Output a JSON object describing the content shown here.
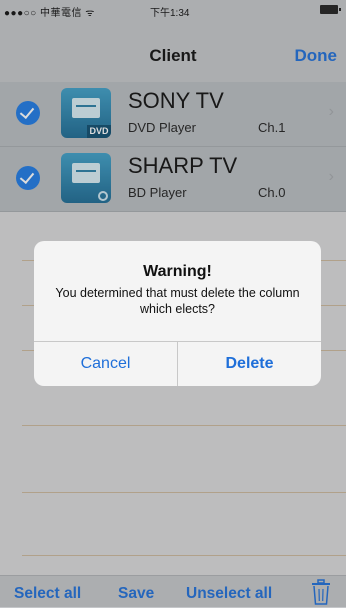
{
  "status_bar": {
    "carrier": "●●●○○ 中華電信 ᯤ",
    "time": "下午1:34"
  },
  "nav": {
    "title": "Client",
    "done_label": "Done"
  },
  "devices": [
    {
      "name": "SONY TV",
      "type": "DVD Player",
      "channel": "Ch.1",
      "icon_tag": "DVD",
      "selected": true
    },
    {
      "name": "SHARP TV",
      "type": "BD Player",
      "channel": "Ch.0",
      "icon_tag": "",
      "selected": true
    }
  ],
  "alert": {
    "title": "Warning!",
    "message": "You determined that must delete the column which elects?",
    "cancel_label": "Cancel",
    "delete_label": "Delete"
  },
  "toolbar": {
    "select_all": "Select all",
    "save": "Save",
    "unselect_all": "Unselect all"
  },
  "colors": {
    "accent": "#1f6fd9",
    "check": "#1f7be5"
  }
}
